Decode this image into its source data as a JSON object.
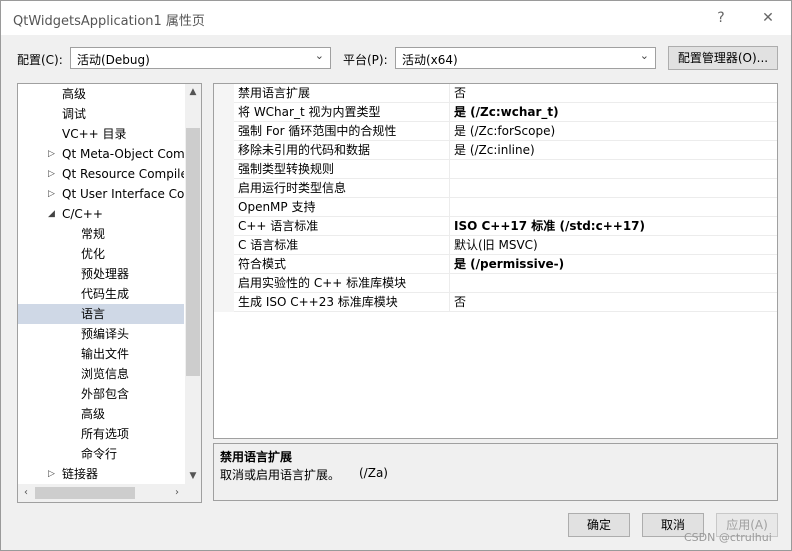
{
  "window": {
    "title": "QtWidgetsApplication1 属性页",
    "help": "?",
    "close": "✕"
  },
  "config": {
    "label": "配置(C):",
    "value": "活动(Debug)"
  },
  "platform": {
    "label": "平台(P):",
    "value": "活动(x64)"
  },
  "config_manager_label": "配置管理器(O)...",
  "tree": [
    {
      "label": "高级",
      "indent": 1
    },
    {
      "label": "调试",
      "indent": 1
    },
    {
      "label": "VC++ 目录",
      "indent": 1
    },
    {
      "label": "Qt Meta-Object Com",
      "indent": 1,
      "expander": "▷"
    },
    {
      "label": "Qt Resource Compile",
      "indent": 1,
      "expander": "▷"
    },
    {
      "label": "Qt User Interface Co",
      "indent": 1,
      "expander": "▷"
    },
    {
      "label": "C/C++",
      "indent": 1,
      "expander": "◢"
    },
    {
      "label": "常规",
      "indent": 2
    },
    {
      "label": "优化",
      "indent": 2
    },
    {
      "label": "预处理器",
      "indent": 2
    },
    {
      "label": "代码生成",
      "indent": 2
    },
    {
      "label": "语言",
      "indent": 2,
      "selected": true
    },
    {
      "label": "预编译头",
      "indent": 2
    },
    {
      "label": "输出文件",
      "indent": 2
    },
    {
      "label": "浏览信息",
      "indent": 2
    },
    {
      "label": "外部包含",
      "indent": 2
    },
    {
      "label": "高级",
      "indent": 2
    },
    {
      "label": "所有选项",
      "indent": 2
    },
    {
      "label": "命令行",
      "indent": 2
    },
    {
      "label": "链接器",
      "indent": 1,
      "expander": "▷"
    }
  ],
  "properties": [
    {
      "name": "禁用语言扩展",
      "value": "否",
      "bold": false
    },
    {
      "name": "将 WChar_t 视为内置类型",
      "value": "是 (/Zc:wchar_t)",
      "bold": true
    },
    {
      "name": "强制 For 循环范围中的合规性",
      "value": "是 (/Zc:forScope)",
      "bold": false
    },
    {
      "name": "移除未引用的代码和数据",
      "value": "是 (/Zc:inline)",
      "bold": false
    },
    {
      "name": "强制类型转换规则",
      "value": "",
      "bold": false
    },
    {
      "name": "启用运行时类型信息",
      "value": "",
      "bold": false
    },
    {
      "name": "OpenMP 支持",
      "value": "",
      "bold": false
    },
    {
      "name": "C++ 语言标准",
      "value": "ISO C++17 标准 (/std:c++17)",
      "bold": true
    },
    {
      "name": "C 语言标准",
      "value": "默认(旧 MSVC)",
      "bold": false
    },
    {
      "name": "符合模式",
      "value": "是 (/permissive-)",
      "bold": true
    },
    {
      "name": "启用实验性的 C++ 标准库模块",
      "value": "",
      "bold": false
    },
    {
      "name": "生成 ISO C++23 标准库模块",
      "value": "否",
      "bold": false
    }
  ],
  "description": {
    "title": "禁用语言扩展",
    "body": "取消或启用语言扩展。",
    "switch": "(/Za)"
  },
  "buttons": {
    "ok": "确定",
    "cancel": "取消",
    "apply": "应用(A)"
  },
  "watermark": "CSDN @ctrulhui"
}
